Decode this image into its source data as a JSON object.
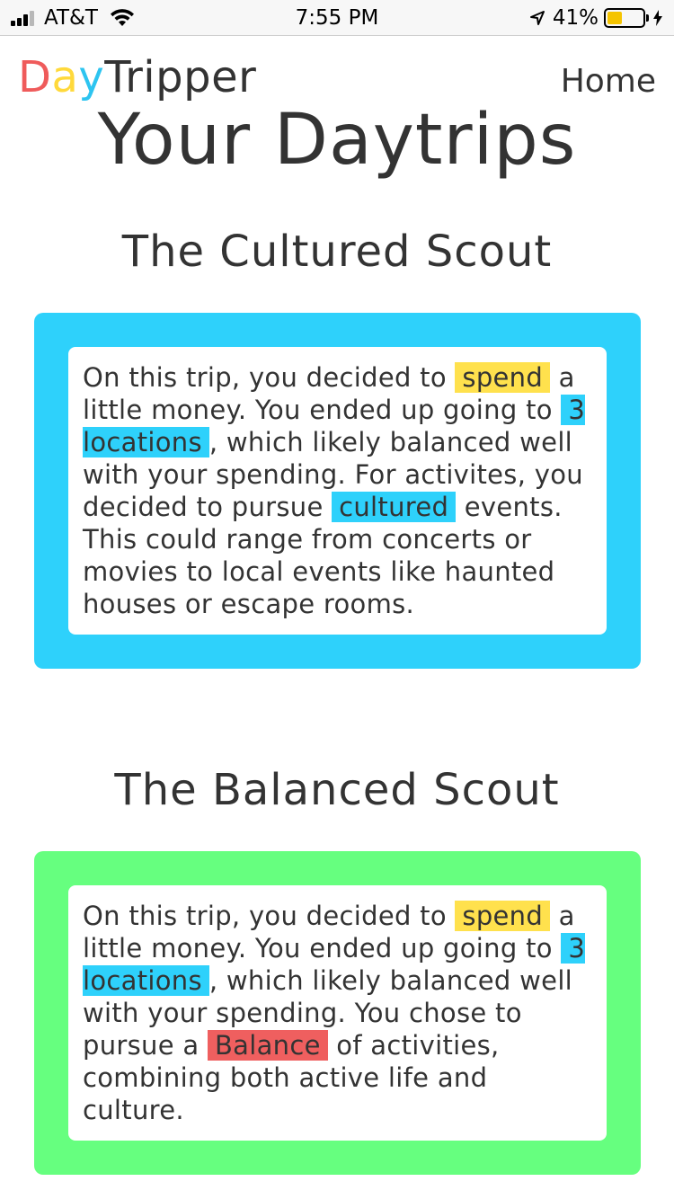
{
  "status_bar": {
    "carrier": "AT&T",
    "time": "7:55 PM",
    "battery_percent": "41%",
    "battery_level": 0.41
  },
  "header": {
    "logo": {
      "d": "D",
      "a": "a",
      "y": "y",
      "rest": "Tripper"
    },
    "home_link": "Home"
  },
  "page_title": "Your Daytrips",
  "colors": {
    "card_blue": "#2ed1fb",
    "card_green": "#66ff7f",
    "highlight_yellow": "#ffe14d",
    "highlight_blue": "#2ed1fb",
    "highlight_red": "#ef5f5f"
  },
  "trips": [
    {
      "title": "The Cultured Scout",
      "text": {
        "p1": "On this trip, you decided to ",
        "spend": "spend",
        "p2": " a little money. You ended up going to ",
        "locations": "3 locations",
        "p3": ", which likely balanced well with your spending. For activites, you decided to pursue ",
        "activity": "cultured",
        "p4": " events. This could range from concerts or movies to local events like haunted houses or escape rooms."
      }
    },
    {
      "title": "The Balanced Scout",
      "text": {
        "p1": "On this trip, you decided to ",
        "spend": "spend",
        "p2": " a little money. You ended up going to ",
        "locations": "3 locations",
        "p3": ", which likely balanced well with your spending. You chose to pursue a ",
        "activity": "Balance",
        "p4": " of activities, combining both active life and culture."
      }
    }
  ]
}
